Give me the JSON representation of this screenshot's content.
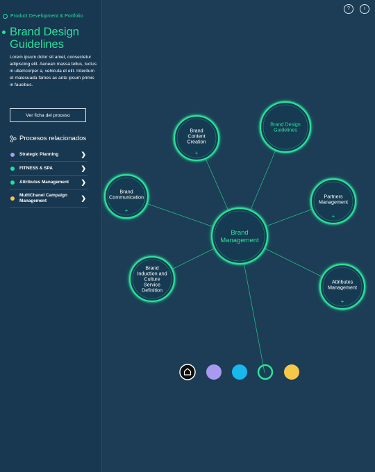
{
  "sidebar": {
    "breadcrumb": "Product Development & Portfolio",
    "title": "Brand Design Guidelines",
    "description": "Lorem ipsum dolor sit amet, consectetur adipiscing elit. Aenean massa tellus, luctus in ullamcorper a, vehicula et elit. Interdum et malesuada fames ac ante ipsum primis in faucibus.",
    "button_label": "Ver ficha del proceso",
    "related_title": "Procesos relacionados",
    "related_icon": "share-nodes-icon",
    "related": [
      {
        "label": "Strategic Planning",
        "color": "#a89af0"
      },
      {
        "label": "FITNESS & SPA",
        "color": "#1fe0a8"
      },
      {
        "label": "Attributes Management",
        "color": "#22e39a"
      },
      {
        "label": "MultiChanel Campaign Management",
        "color": "#f5c84a"
      }
    ]
  },
  "top_icons": [
    {
      "name": "help-icon",
      "glyph": "?"
    },
    {
      "name": "info-icon",
      "glyph": "i"
    }
  ],
  "graph": {
    "accent": "#27e39a",
    "center": {
      "label": [
        "Brand",
        "Management"
      ]
    },
    "nodes": [
      {
        "id": "content",
        "label": [
          "Brand",
          "Content",
          "Creation"
        ],
        "plus": "+"
      },
      {
        "id": "guidelines",
        "label": [
          "Brand Design",
          "Guidelines"
        ],
        "highlight": true
      },
      {
        "id": "communication",
        "label": [
          "Brand",
          "Communication"
        ],
        "plus": "+"
      },
      {
        "id": "partners",
        "label": [
          "Partners",
          "Management"
        ],
        "plus": "+"
      },
      {
        "id": "induction",
        "label": [
          "Brand",
          "Induction and",
          "Culture",
          "Service",
          "Definition"
        ]
      },
      {
        "id": "attributes",
        "label": [
          "Attributes",
          "Management"
        ],
        "plus": "+"
      }
    ]
  },
  "swatches": [
    {
      "name": "home-button",
      "type": "home",
      "icon": "home-icon"
    },
    {
      "name": "swatch-purple",
      "color": "#a89af0"
    },
    {
      "name": "swatch-blue",
      "color": "#18b8ec"
    },
    {
      "name": "swatch-green-active",
      "color": "#27e39a",
      "ring": true
    },
    {
      "name": "swatch-yellow",
      "color": "#f5c84a"
    }
  ]
}
